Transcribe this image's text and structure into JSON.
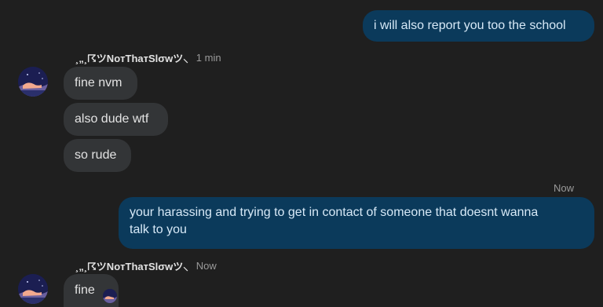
{
  "messages": {
    "outgoing_1": "i will also report you too the school",
    "sender_1_name": "¸„¸☈ツNoтThaтSlσwツ⸜",
    "sender_1_time": "1 min",
    "incoming_1": "fine nvm",
    "incoming_2": "also dude wtf",
    "incoming_3": "so rude",
    "outgoing_2_time": "Now",
    "outgoing_2_line1": "your harassing and trying to get in contact of someone that doesnt wanna",
    "outgoing_2_line2": "talk to you",
    "sender_2_name": "¸„¸☈ツNoтThaтSlσwツ⸜",
    "sender_2_time": "Now",
    "incoming_4": "fine"
  },
  "colors": {
    "background": "#1f1f1f",
    "outgoing_bubble": "#0b3a5b",
    "incoming_bubble": "#333537"
  }
}
